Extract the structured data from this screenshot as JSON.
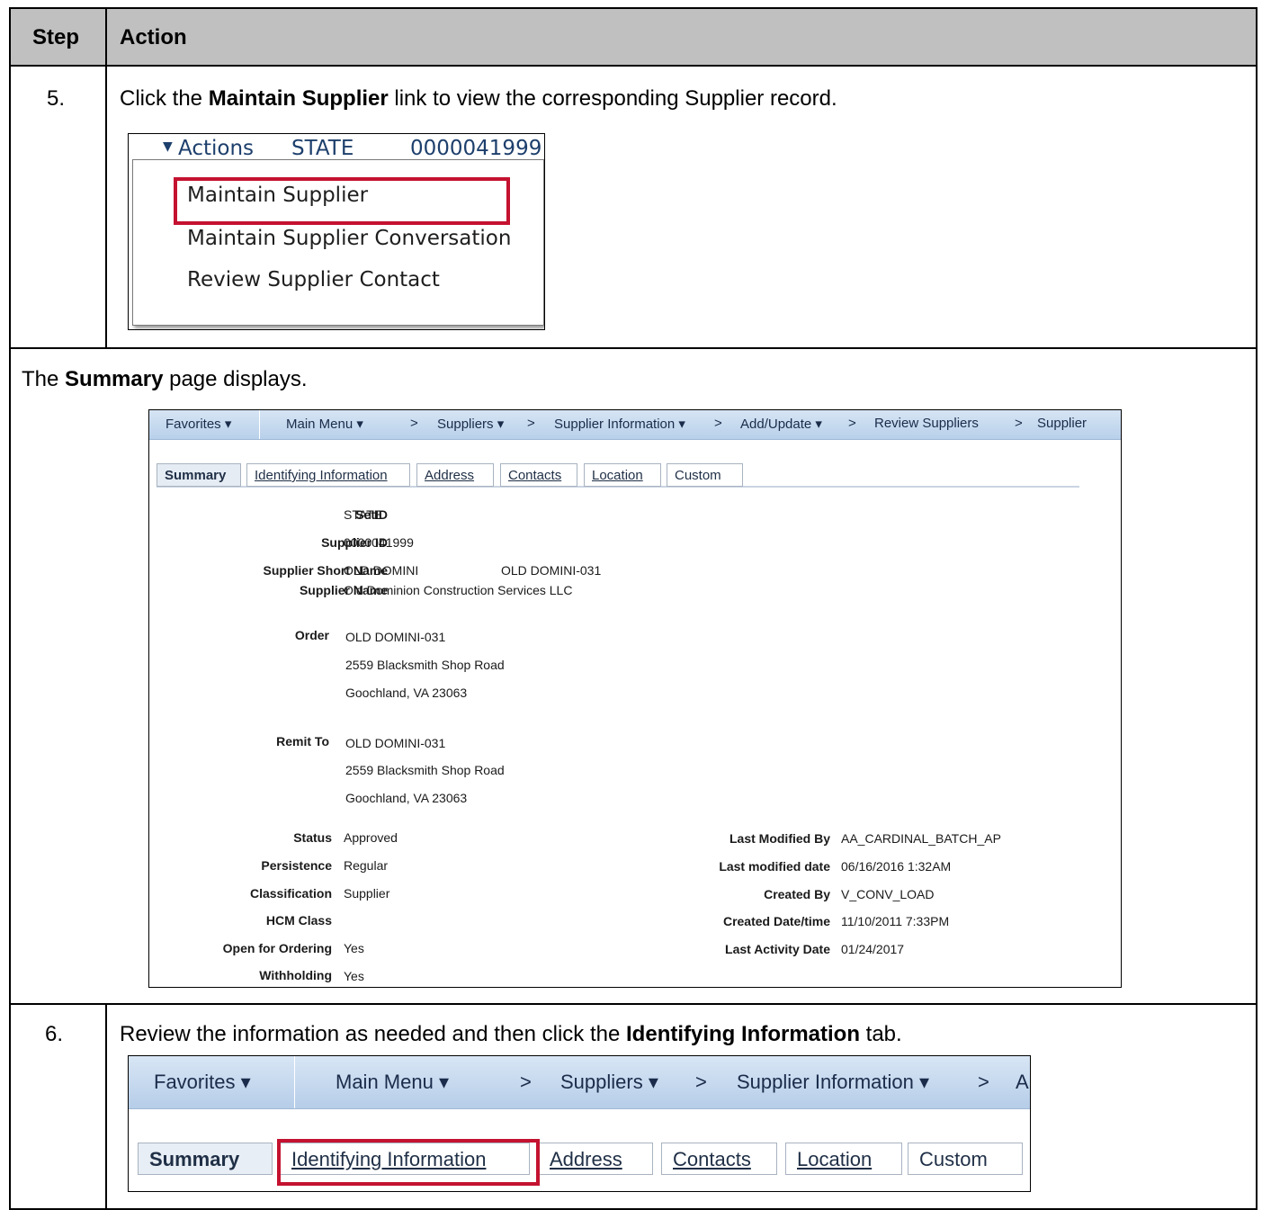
{
  "header": {
    "step": "Step",
    "action": "Action"
  },
  "step5": {
    "number": "5.",
    "pre": "Click the ",
    "bold": "Maintain Supplier",
    "post": " link to view the corresponding Supplier record."
  },
  "actions_menu": {
    "trigger": "Actions",
    "setid": "STATE",
    "supplier_id": "0000041999",
    "items": [
      "Maintain Supplier",
      "Maintain Supplier Conversation",
      "Review Supplier Contact"
    ]
  },
  "summary_note": {
    "pre": "The ",
    "bold": "Summary",
    "post": " page displays."
  },
  "nav": {
    "favorites": "Favorites",
    "main_menu": "Main Menu",
    "suppliers": "Suppliers",
    "supplier_information": "Supplier Information",
    "add_update": "Add/Update",
    "review_suppliers": "Review Suppliers",
    "supplier": "Supplier",
    "sep": ">"
  },
  "tabs": [
    "Summary",
    "Identifying Information",
    "Address",
    "Contacts",
    "Location",
    "Custom"
  ],
  "summary": {
    "setid_label": "SetID",
    "setid": "STATE",
    "supplier_id_label": "Supplier ID",
    "supplier_id": "0000041999",
    "short_name_label": "Supplier Short Name",
    "short_name": "OLD DOMINI",
    "short_name_loc": "OLD DOMINI-031",
    "name_label": "Supplier Name",
    "name": "Old Dominion Construction Services LLC",
    "order_label": "Order",
    "order_lines": [
      "OLD DOMINI-031",
      "2559 Blacksmith Shop Road",
      "Goochland, VA  23063"
    ],
    "remit_label": "Remit To",
    "remit_lines": [
      "OLD DOMINI-031",
      "2559 Blacksmith Shop Road",
      "Goochland, VA  23063"
    ],
    "left_fields": [
      {
        "label": "Status",
        "value": "Approved"
      },
      {
        "label": "Persistence",
        "value": "Regular"
      },
      {
        "label": "Classification",
        "value": "Supplier"
      },
      {
        "label": "HCM Class",
        "value": ""
      },
      {
        "label": "Open for Ordering",
        "value": "Yes"
      },
      {
        "label": "Withholding",
        "value": "Yes"
      }
    ],
    "right_fields": [
      {
        "label": "Last Modified By",
        "value": "AA_CARDINAL_BATCH_AP"
      },
      {
        "label": "Last modified date",
        "value": "06/16/2016  1:32AM"
      },
      {
        "label": "Created By",
        "value": "V_CONV_LOAD"
      },
      {
        "label": "Created Date/time",
        "value": "11/10/2011  7:33PM"
      },
      {
        "label": "Last Activity Date",
        "value": "01/24/2017"
      }
    ]
  },
  "step6": {
    "number": "6.",
    "pre": "Review the information as needed and then click the ",
    "bold": "Identifying Information",
    "post": " tab."
  },
  "nav2": {
    "favorites": "Favorites",
    "main_menu": "Main Menu",
    "suppliers": "Suppliers",
    "supplier_information": "Supplier Information",
    "cut": "A"
  },
  "colors": {
    "highlight": "#c41230",
    "header_bg": "#c0c0c0",
    "navbar": "#c7daee"
  }
}
